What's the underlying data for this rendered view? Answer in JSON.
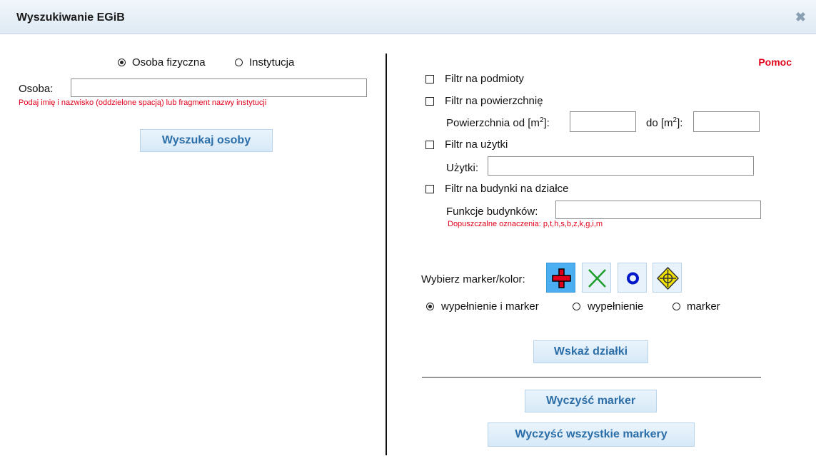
{
  "dialog": {
    "title": "Wyszukiwanie EGiB",
    "close_icon": "close-icon"
  },
  "left": {
    "radio_person": "Osoba fizyczna",
    "radio_institution": "Instytucja",
    "selected_type": "Osoba fizyczna",
    "person_label": "Osoba:",
    "person_value": "",
    "person_hint": "Podaj imię i nazwisko (oddzielone spacją) lub fragment nazwy instytucji",
    "search_button": "Wyszukaj osoby"
  },
  "right": {
    "help_link": "Pomoc",
    "filter_subjects": "Filtr na podmioty",
    "filter_area": "Filtr na powierzchnię",
    "area_from_label": "Powierzchnia od [m",
    "area_to_label": "do [m",
    "area_sup": "2",
    "area_label_end": "]:",
    "area_from_value": "",
    "area_to_value": "",
    "filter_use": "Filtr na użytki",
    "use_label": "Użytki:",
    "use_value": "",
    "filter_buildings": "Filtr na budynki na działce",
    "building_functions_label": "Funkcje budynków:",
    "building_functions_value": "",
    "building_hint": "Dopuszczalne oznaczenia: p,t,h,s,b,z,k,g,i,m",
    "marker_label": "Wybierz marker/kolor:",
    "markers": [
      "red-cross-marker",
      "green-x-marker",
      "blue-ring-marker",
      "yellow-target-marker"
    ],
    "selected_marker": "red-cross-marker",
    "mode_options": [
      "wypełnienie i marker",
      "wypełnienie",
      "marker"
    ],
    "selected_mode": "wypełnienie i marker",
    "show_parcels_button": "Wskaż działki",
    "clear_marker_button": "Wyczyść marker",
    "clear_all_markers_button": "Wyczyść wszystkie markery"
  },
  "colors": {
    "accent_text": "#2b6ea8",
    "hint_red": "#e0001a",
    "selected_marker_bg": "#4aaef0"
  }
}
